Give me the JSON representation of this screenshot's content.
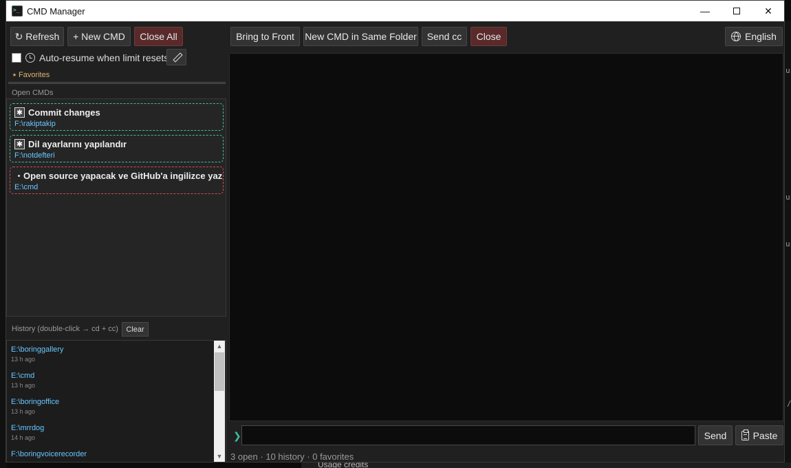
{
  "window": {
    "title": "CMD Manager",
    "controls": {
      "minimize": "—",
      "close": "✕"
    }
  },
  "toolbar_left": {
    "refresh": "↻ Refresh",
    "new_cmd": "+ New CMD",
    "close_all": "Close All"
  },
  "toolbar_right": {
    "bring_to_front": "Bring to Front",
    "new_cmd_same_folder": "New CMD in Same Folder",
    "send_cc": "Send cc",
    "close": "Close",
    "language": "English"
  },
  "auto_resume": {
    "label": "Auto-resume when limit resets",
    "checked": false
  },
  "favorites": {
    "label": "⭑ Favorites"
  },
  "open_cmds": {
    "label": "Open CMDs",
    "items": [
      {
        "icon": "✱",
        "title": "Commit changes",
        "path": "F:\\rakiptakip",
        "state": "active",
        "color": "#3fbf9f"
      },
      {
        "icon": "✱",
        "title": "Dil ayarlarını yapılandır",
        "path": "F:\\notdefteri",
        "state": "active",
        "color": "#3fbf9f"
      },
      {
        "icon": "·",
        "title": "Open source yapacak ve GitHub'a ingilizce yaz",
        "path": "E:\\cmd",
        "state": "idle",
        "color": "#d94a5a"
      }
    ]
  },
  "history": {
    "label": "History (double-click → cd + cc)",
    "clear": "Clear",
    "items": [
      {
        "path": "E:\\boringgallery",
        "time": "13 h ago"
      },
      {
        "path": "E:\\cmd",
        "time": "13 h ago"
      },
      {
        "path": "E:\\boringoffice",
        "time": "13 h ago"
      },
      {
        "path": "E:\\mrrdog",
        "time": "14 h ago"
      },
      {
        "path": "F:\\boringvoicerecorder",
        "time": ""
      }
    ],
    "scroll_up": "▲",
    "scroll_down": "▼"
  },
  "input": {
    "prompt": "❯",
    "value": "",
    "placeholder": "",
    "send": "Send",
    "paste": "Paste"
  },
  "status": "3 open · 10 history · 0 favorites",
  "background": {
    "right_fragments": [
      "us",
      "us",
      "us",
      "/"
    ],
    "bottom_fragment": "Usage credits"
  },
  "colors": {
    "accent_active": "#3fbf9f",
    "accent_idle": "#d94a5a",
    "path_blue": "#68c8ff",
    "danger_button": "#5a2a2a",
    "favorites_gold": "#e0b36a"
  }
}
